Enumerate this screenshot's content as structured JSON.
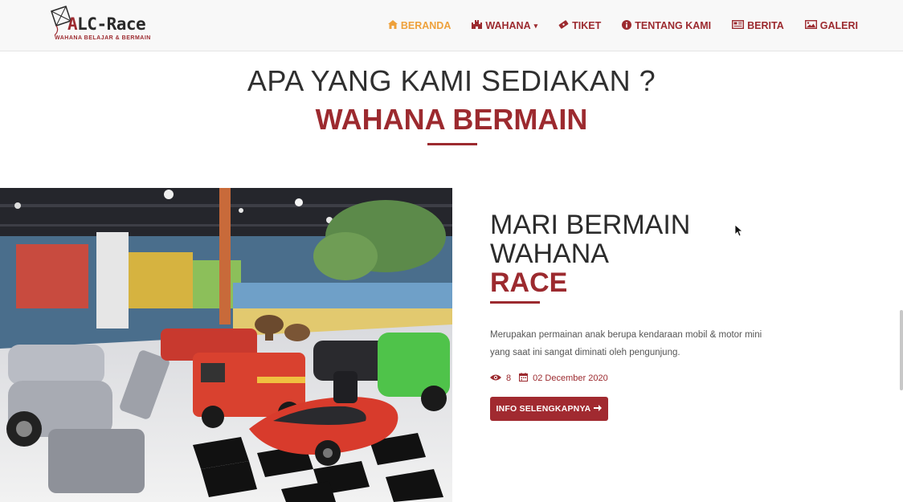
{
  "brand": {
    "name_first": "A",
    "name_rest": "LC-Race",
    "tagline": "WAHANA BELAJAR & BERMAIN"
  },
  "nav": {
    "items": [
      {
        "label": "BERANDA",
        "icon": "home-icon",
        "active": true
      },
      {
        "label": "WAHANA",
        "icon": "castle-icon",
        "dropdown": true
      },
      {
        "label": "TIKET",
        "icon": "ticket-icon"
      },
      {
        "label": "TENTANG KAMI",
        "icon": "info-icon"
      },
      {
        "label": "BERITA",
        "icon": "newspaper-icon"
      },
      {
        "label": "GALERI",
        "icon": "image-icon"
      }
    ]
  },
  "section": {
    "heading": "APA YANG KAMI SEDIAKAN ?",
    "subheading": "WAHANA BERMAIN"
  },
  "card": {
    "title_line1": "MARI BERMAIN",
    "title_line2": "WAHANA",
    "title_highlight": "RACE",
    "description": "Merupakan permainan anak berupa kendaraan mobil & motor mini yang saat ini sangat diminati oleh pengunjung.",
    "views": "8",
    "date": "02 December 2020",
    "button_label": "INFO SELENGKAPNYA",
    "image_alt": "ride-on toy cars photo"
  },
  "colors": {
    "brand": "#9c2a2f",
    "active_nav": "#eea13b",
    "button": "#a12a30"
  }
}
